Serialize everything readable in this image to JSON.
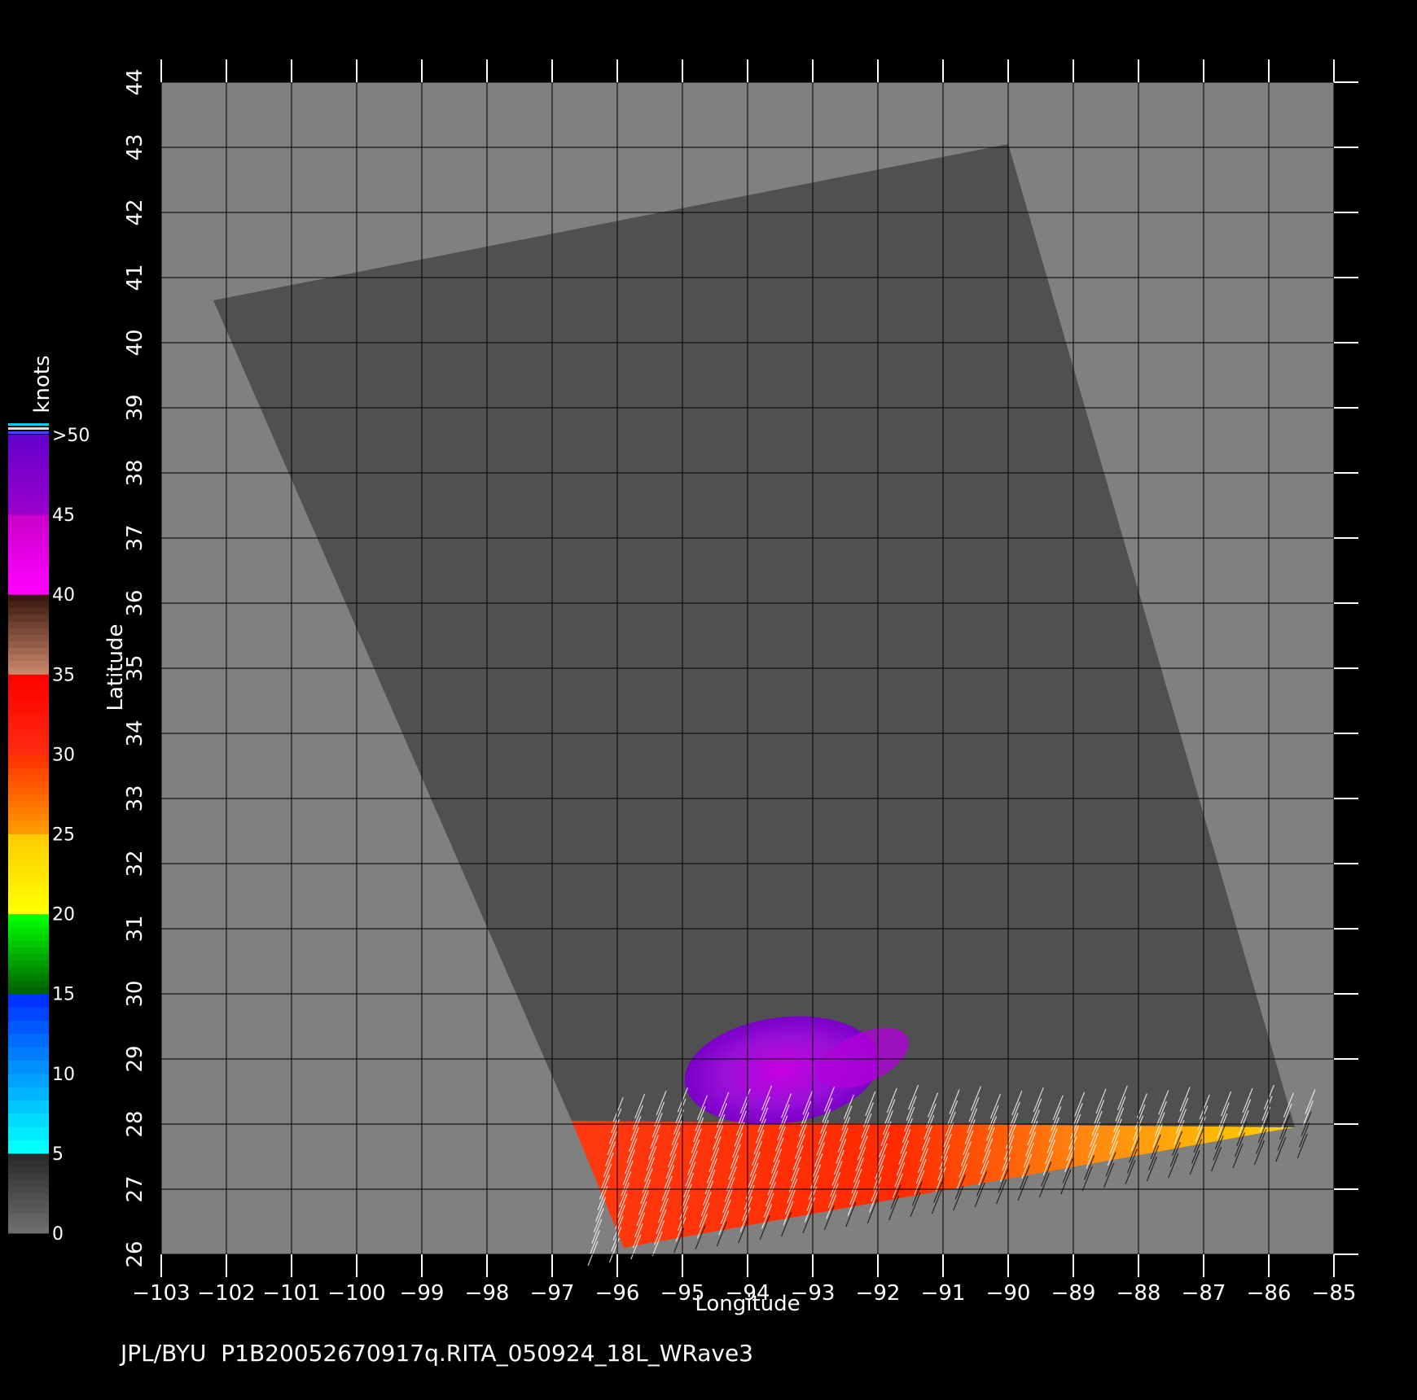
{
  "footer": {
    "text": "JPL/BYU  P1B20052670917q.RITA_050924_18L_WRave3"
  },
  "axes": {
    "x": {
      "label": "Longitude",
      "min": -103,
      "max": -85,
      "ticks": [
        "−103",
        "−102",
        "−101",
        "−100",
        "−99",
        "−98",
        "−97",
        "−96",
        "−95",
        "−94",
        "−93",
        "−92",
        "−91",
        "−90",
        "−89",
        "−88",
        "−87",
        "−86",
        "−85"
      ]
    },
    "y": {
      "label": "Latitude",
      "min": 26,
      "max": 44,
      "ticks": [
        "26",
        "27",
        "28",
        "29",
        "30",
        "31",
        "32",
        "33",
        "34",
        "35",
        "36",
        "37",
        "38",
        "39",
        "40",
        "41",
        "42",
        "43",
        "44"
      ]
    }
  },
  "colorbar": {
    "unit": "knots",
    "labels": [
      "0",
      "5",
      "10",
      "15",
      "20",
      "25",
      "30",
      "35",
      "40",
      "45",
      ">50"
    ],
    "bands": [
      {
        "from": 0,
        "to": 5,
        "colors": [
          "#6e6e6e",
          "#2a2a2a"
        ]
      },
      {
        "from": 5,
        "to": 15,
        "colors": [
          "#00ffff",
          "#0033ff"
        ]
      },
      {
        "from": 15,
        "to": 20,
        "colors": [
          "#006400",
          "#00ff00"
        ]
      },
      {
        "from": 20,
        "to": 25,
        "colors": [
          "#ffff00",
          "#ffcc00"
        ]
      },
      {
        "from": 25,
        "to": 30,
        "colors": [
          "#ff9900",
          "#ff3300"
        ]
      },
      {
        "from": 30,
        "to": 35,
        "colors": [
          "#ff2a10",
          "#ff0000"
        ]
      },
      {
        "from": 35,
        "to": 40,
        "colors": [
          "#c8846a",
          "#3a1a10"
        ]
      },
      {
        "from": 40,
        "to": 45,
        "colors": [
          "#ff00ff",
          "#cc00cc"
        ]
      },
      {
        "from": 45,
        "to": 50,
        "colors": [
          "#9900cc",
          "#6600cc"
        ]
      }
    ]
  },
  "colors": {
    "background": "#000000",
    "plot_area": "#808080",
    "swath": "#505050",
    "grid": "#000000"
  },
  "swath": {
    "corners_lonlat": [
      [
        -102.2,
        40.65
      ],
      [
        -90.0,
        43.05
      ],
      [
        -85.6,
        27.95
      ],
      [
        -96.7,
        28.05
      ]
    ]
  },
  "wind_field": {
    "corners_lonlat": [
      [
        -96.7,
        28.05
      ],
      [
        -85.6,
        27.95
      ],
      [
        -85.9,
        27.9
      ],
      [
        -95.9,
        26.1
      ]
    ]
  }
}
